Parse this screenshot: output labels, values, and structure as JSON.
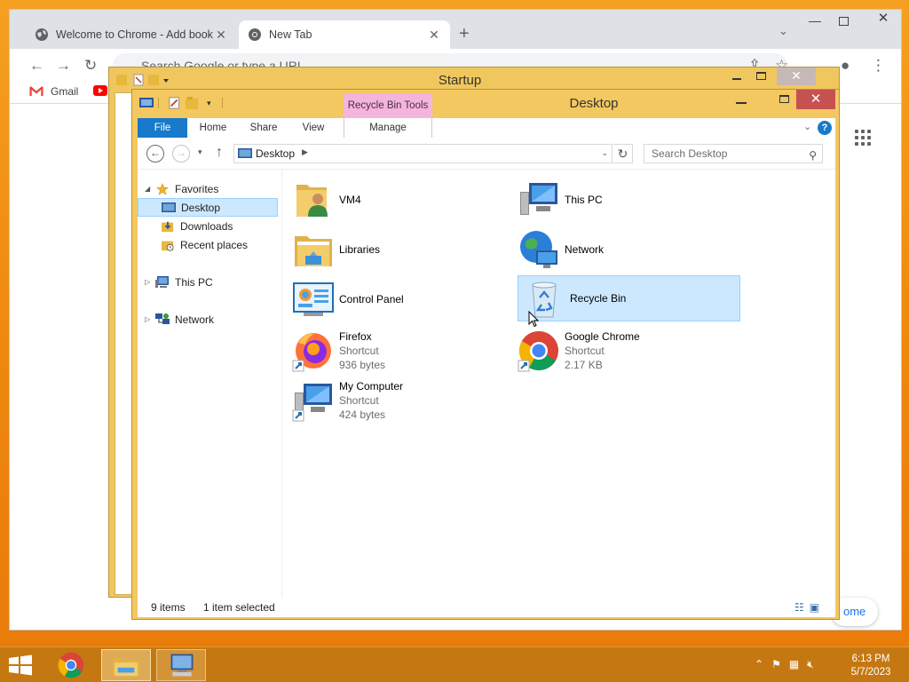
{
  "chrome": {
    "tabs": [
      {
        "title": "Welcome to Chrome - Add book"
      },
      {
        "title": "New Tab"
      }
    ],
    "new_tab": "+",
    "omnibox_placeholder": "Search Google or type a URL",
    "bookmarks": [
      {
        "label": "Gmail"
      }
    ],
    "home_button": "ome"
  },
  "startup": {
    "title": "Startup"
  },
  "explorer": {
    "title": "Desktop",
    "context_tab_group": "Recycle Bin Tools",
    "ribbon_tabs": [
      "File",
      "Home",
      "Share",
      "View",
      "Manage"
    ],
    "address": "Desktop",
    "search_placeholder": "Search Desktop",
    "nav": {
      "favorites": "Favorites",
      "desktop": "Desktop",
      "downloads": "Downloads",
      "recent": "Recent places",
      "this_pc": "This PC",
      "network": "Network"
    },
    "items": [
      {
        "name": "VM4",
        "sub1": "",
        "sub2": ""
      },
      {
        "name": "This PC",
        "sub1": "",
        "sub2": ""
      },
      {
        "name": "Libraries",
        "sub1": "",
        "sub2": ""
      },
      {
        "name": "Network",
        "sub1": "",
        "sub2": ""
      },
      {
        "name": "Control Panel",
        "sub1": "",
        "sub2": ""
      },
      {
        "name": "Recycle Bin",
        "sub1": "",
        "sub2": ""
      },
      {
        "name": "Firefox",
        "sub1": "Shortcut",
        "sub2": "936 bytes"
      },
      {
        "name": "Google Chrome",
        "sub1": "Shortcut",
        "sub2": "2.17 KB"
      },
      {
        "name": "My Computer",
        "sub1": "Shortcut",
        "sub2": "424 bytes"
      }
    ],
    "status": {
      "count": "9 items",
      "selected": "1 item selected"
    }
  },
  "taskbar": {
    "time": "6:13 PM",
    "date": "5/7/2023"
  },
  "colors": {
    "selection": "#cce8ff",
    "selection_border": "#99d1ff",
    "file_tab": "#1979ca",
    "context_tab": "#f4b5dd",
    "close": "#c75050"
  }
}
